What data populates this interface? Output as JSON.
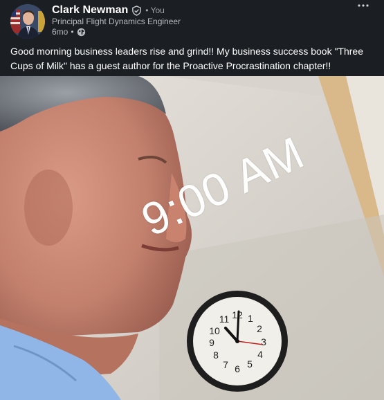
{
  "post": {
    "author": {
      "name": "Clark Newman",
      "connection": "• You",
      "headline": "Principal Flight Dynamics Engineer",
      "time_ago": "6mo"
    },
    "meta_separator": "•",
    "more_icon": "more-horizontal-icon",
    "visibility_icon": "globe-icon",
    "verified_icon": "verified-shield-icon",
    "text": "Good morning business leaders rise and grind!! My business success book \"Three Cups of Milk\" has a guest author for the Proactive Procrastination chapter!!",
    "image": {
      "overlay_text": "9:00 AM",
      "clock_numbers": [
        "12",
        "1",
        "2",
        "3",
        "4",
        "5",
        "6",
        "7",
        "8",
        "9",
        "10",
        "11"
      ]
    }
  },
  "colors": {
    "background": "#1b1f23",
    "text_primary": "#ffffff",
    "text_secondary": "#b9bcbf"
  }
}
